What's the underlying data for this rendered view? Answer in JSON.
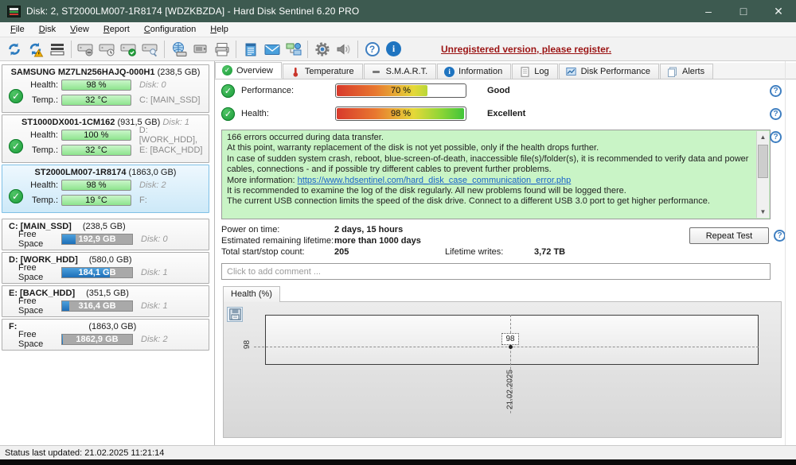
{
  "window": {
    "title": "Disk: 2, ST2000LM007-1R8174 [WDZKBZDA]  -  Hard Disk Sentinel 6.20 PRO",
    "minimize": "–",
    "maximize": "□",
    "close": "✕"
  },
  "menu": {
    "items": [
      "File",
      "Disk",
      "View",
      "Report",
      "Configuration",
      "Help"
    ]
  },
  "toolbar": {
    "register_link": "Unregistered version, please register.",
    "help_glyph": "?",
    "info_glyph": "i"
  },
  "sidebar": {
    "disks": [
      {
        "name": "SAMSUNG MZ7LN256HAJQ-000H1",
        "size": "(238,5 GB)",
        "header_right": "",
        "health_label": "Health:",
        "health": "98 %",
        "health_right": "Disk: 0",
        "temp_label": "Temp.:",
        "temp": "32 °C",
        "temp_right": "C: [MAIN_SSD]"
      },
      {
        "name": "ST1000DX001-1CM162",
        "size": "(931,5 GB)",
        "header_right": "Disk: 1",
        "health_label": "Health:",
        "health": "100 %",
        "health_right": "D: [WORK_HDD],",
        "temp_label": "Temp.:",
        "temp": "32 °C",
        "temp_right": "E: [BACK_HDD]"
      },
      {
        "name": "ST2000LM007-1R8174",
        "size": "(1863,0 GB)",
        "header_right": "",
        "health_label": "Health:",
        "health": "98 %",
        "health_right": "Disk: 2",
        "temp_label": "Temp.:",
        "temp": "19 °C",
        "temp_right": "F:"
      }
    ],
    "partitions": [
      {
        "name": "C: [MAIN_SSD]",
        "size": "(238,5 GB)",
        "free_label": "Free Space",
        "free": "192,9 GB",
        "disk": "Disk: 0",
        "used_pct": 19
      },
      {
        "name": "D: [WORK_HDD]",
        "size": "(580,0 GB)",
        "free_label": "Free Space",
        "free": "184,1 GB",
        "disk": "Disk: 1",
        "used_pct": 68
      },
      {
        "name": "E: [BACK_HDD]",
        "size": "(351,5 GB)",
        "free_label": "Free Space",
        "free": "316,4 GB",
        "disk": "Disk: 1",
        "used_pct": 10
      },
      {
        "name": "F:",
        "size": "(1863,0 GB)",
        "free_label": "Free Space",
        "free": "1862,9 GB",
        "disk": "Disk: 2",
        "used_pct": 1
      }
    ],
    "check_glyph": "✓"
  },
  "tabs": [
    {
      "label": "Overview"
    },
    {
      "label": "Temperature"
    },
    {
      "label": "S.M.A.R.T."
    },
    {
      "label": "Information"
    },
    {
      "label": "Log"
    },
    {
      "label": "Disk Performance"
    },
    {
      "label": "Alerts"
    }
  ],
  "overview": {
    "performance_label": "Performance:",
    "performance_value": "70 %",
    "performance_pct": 70,
    "performance_rating": "Good",
    "health_label": "Health:",
    "health_value": "98 %",
    "health_pct": 98,
    "health_rating": "Excellent",
    "message": {
      "line0": "166 errors occurred during data transfer.",
      "line1": "At this point, warranty replacement of the disk is not yet possible, only if the health drops further.",
      "line2": "In case of sudden system crash, reboot, blue-screen-of-death, inaccessible file(s)/folder(s), it is recommended to verify data and power cables, connections - and if possible try different cables to prevent further problems.",
      "link_prefix": "More information: ",
      "link_text": "https://www.hdsentinel.com/hard_disk_case_communication_error.php",
      "line3": "It is recommended to examine the log of the disk regularly. All new problems found will be logged there.",
      "line4": "The current USB connection limits the speed of the disk drive. Connect to a different USB 3.0 port to get higher performance."
    },
    "stats": {
      "power_on_label": "Power on time:",
      "power_on": "2 days, 15 hours",
      "lifetime_label": "Estimated remaining lifetime:",
      "lifetime": "more than 1000 days",
      "startstop_label": "Total start/stop count:",
      "startstop": "205",
      "writes_label": "Lifetime writes:",
      "writes": "3,72 TB"
    },
    "repeat_test_label": "Repeat Test",
    "comment_placeholder": "Click to add comment ..."
  },
  "chart": {
    "tab_label": "Health (%)"
  },
  "chart_data": {
    "type": "line",
    "title": "Health (%)",
    "x": [
      "21.02.2025"
    ],
    "values": [
      98
    ],
    "yticks": [
      "98"
    ],
    "xticks": [
      "21.02.2025"
    ],
    "point_label": "98",
    "grid": "dashed-crosshair",
    "legend": "none"
  },
  "statusbar": {
    "text": "Status last updated: 21.02.2025 11:21:14"
  }
}
